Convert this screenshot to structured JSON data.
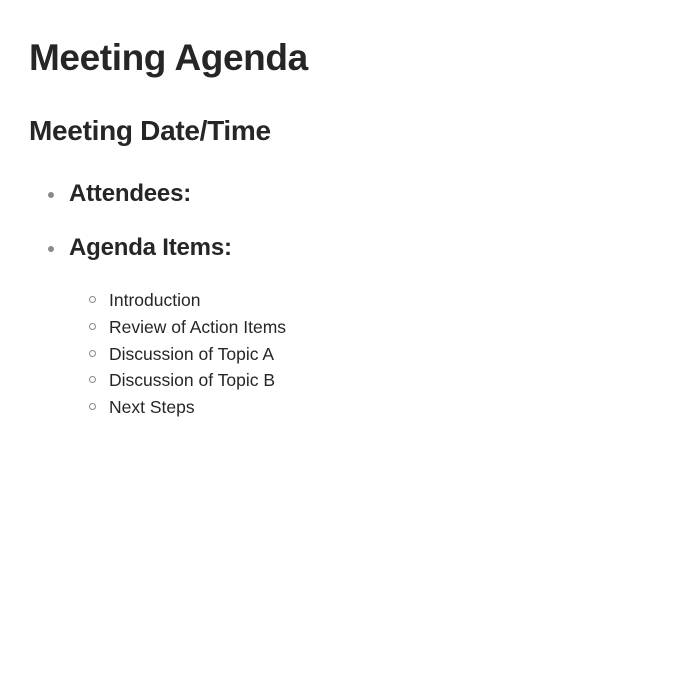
{
  "document": {
    "title": "Meeting Agenda",
    "subtitle": "Meeting Date/Time",
    "sections": [
      {
        "label": "Attendees:"
      },
      {
        "label": "Agenda Items:"
      }
    ],
    "agenda_items": [
      "Introduction",
      "Review of Action Items",
      "Discussion of Topic A",
      "Discussion of Topic B",
      "Next Steps"
    ]
  }
}
